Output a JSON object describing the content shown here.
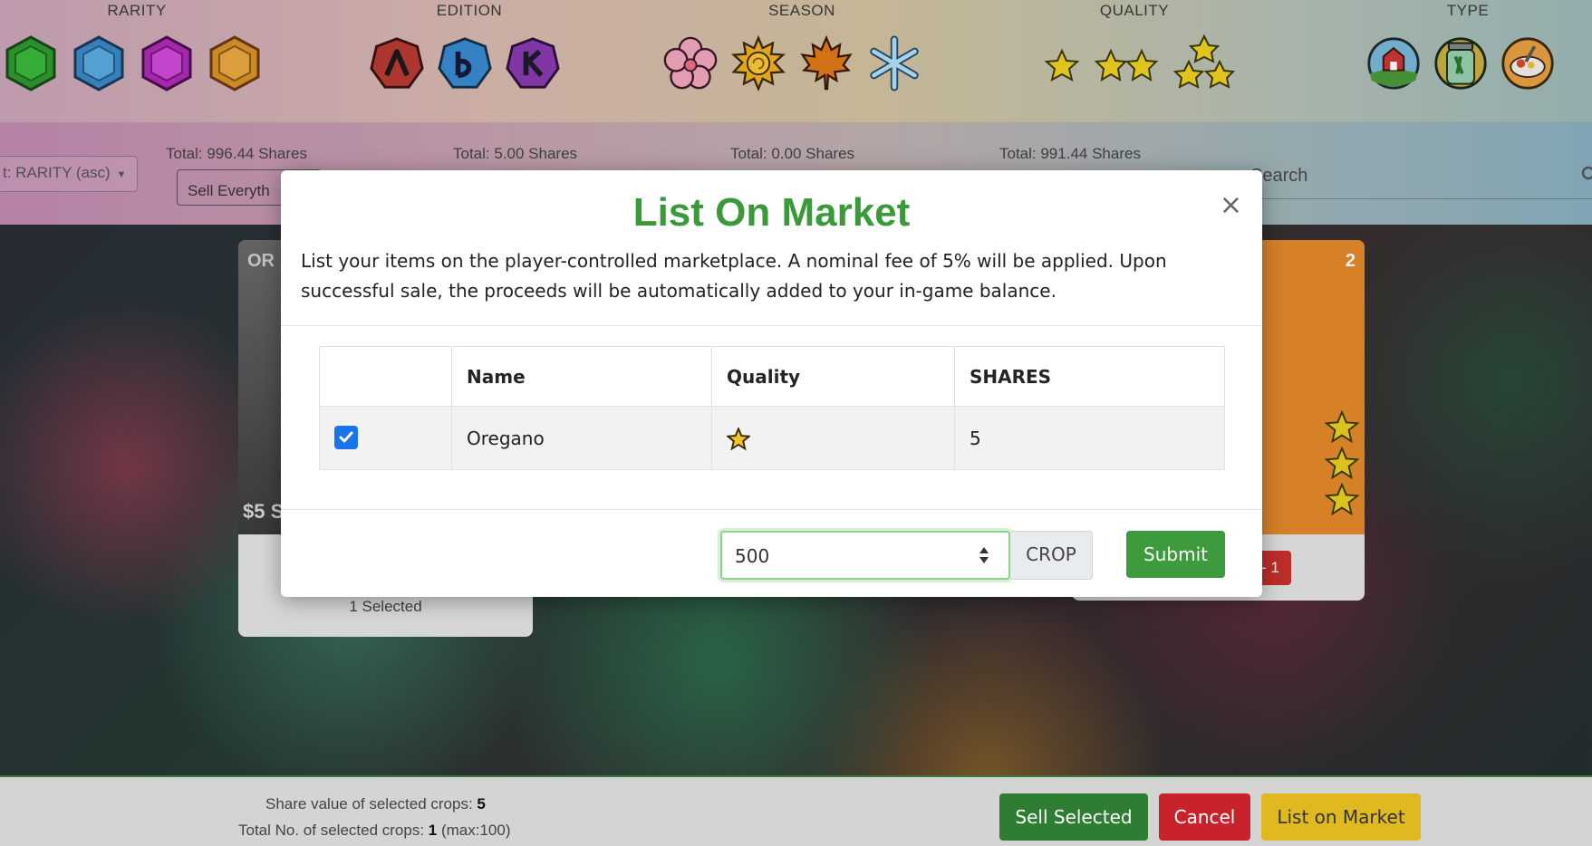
{
  "filters": {
    "rarity": {
      "title": "RARITY",
      "icons": [
        "green-gem-icon",
        "blue-gem-icon",
        "purple-gem-icon",
        "orange-gem-icon"
      ]
    },
    "edition": {
      "title": "EDITION",
      "icons": [
        "edition-a-icon",
        "edition-b-icon",
        "edition-r-icon"
      ]
    },
    "season": {
      "title": "SEASON",
      "icons": [
        "flower-icon",
        "sun-icon",
        "maple-leaf-icon",
        "snowflake-icon"
      ]
    },
    "quality": {
      "title": "QUALITY",
      "icons": [
        "one-star-icon",
        "two-star-icon",
        "three-star-icon"
      ]
    },
    "type": {
      "title": "TYPE",
      "icons": [
        "barn-icon",
        "jar-icon",
        "dish-icon"
      ]
    }
  },
  "subbar": {
    "sort_label": "t: RARITY (asc)",
    "totals": [
      "Total: 996.44 Shares",
      "Total: 5.00 Shares",
      "Total: 0.00 Shares",
      "Total: 991.44 Shares"
    ],
    "sell_everything_label": "Sell Everyth",
    "search_placeholder": "Search"
  },
  "cards": {
    "left": {
      "code": "OR",
      "price": "$5 S",
      "selected_text": "1 Selected"
    },
    "right": {
      "count": "2",
      "minus_label": "- 1"
    }
  },
  "modal": {
    "title": "List On Market",
    "description": "List your items on the player-controlled marketplace. A nominal fee of 5% will be applied. Upon successful sale, the proceeds will be automatically added to your in-game balance.",
    "table": {
      "headers": [
        "",
        "Name",
        "Quality",
        "SHARES"
      ],
      "rows": [
        {
          "checked": true,
          "name": "Oregano",
          "quality_stars": 1,
          "shares": "5"
        }
      ]
    },
    "price_value": "500",
    "currency": "CROP",
    "submit_label": "Submit"
  },
  "bottombar": {
    "share_value_label": "Share value of selected crops: ",
    "share_value": "5",
    "total_label": "Total No. of selected crops: ",
    "total_value": "1",
    "total_max": " (max:100)",
    "sell_selected_label": "Sell Selected",
    "cancel_label": "Cancel",
    "list_on_market_label": "List on Market"
  },
  "colors": {
    "accent_green": "#3a9a3a",
    "danger_red": "#c8232c",
    "warning_yellow": "#e0b820",
    "checkbox_blue": "#1a73e8"
  }
}
